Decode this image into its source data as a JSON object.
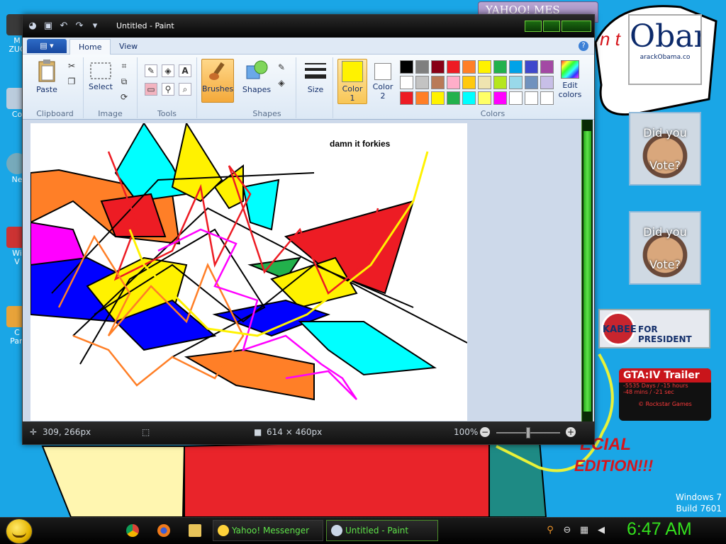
{
  "desktop": {
    "icons": [
      {
        "label": "M\nZUC"
      },
      {
        "label": "Co"
      },
      {
        "label": "Ne"
      },
      {
        "label": "Wi\nV"
      },
      {
        "label": "C\nPan"
      }
    ],
    "wallpaper_text": {
      "top": "n t",
      "bottom": "MID\nSOR\nSPECIAL\nEDITION!!!"
    },
    "watermark": {
      "os": "Windows 7",
      "build": "Build 7601"
    }
  },
  "gadgets": {
    "obama": {
      "big": "Obar",
      "small": "arackObama.co"
    },
    "vote1": {
      "line1": "Did you",
      "line2": "Vote?"
    },
    "vote2": {
      "line1": "Did you",
      "line2": "Vote?"
    },
    "huckabee": {
      "name": "KABEE",
      "suffix": "FOR PRESIDENT"
    },
    "gta": {
      "title": "GTA:IV Trailer",
      "line1": "-5535 Days / -15 hours",
      "line2": "-48 mins / -21 sec",
      "credit": "© Rockstar Games"
    }
  },
  "yahoo_bg": {
    "title": "YAHOO! MES"
  },
  "paint": {
    "title": "Untitled - Paint",
    "tabs": {
      "app_menu": "▤ ▾",
      "home": "Home",
      "view": "View"
    },
    "groups": {
      "clipboard": "Clipboard",
      "image": "Image",
      "tools": "Tools",
      "shapes": "Shapes",
      "colors": "Colors"
    },
    "buttons": {
      "paste": "Paste",
      "select": "Select",
      "brushes": "Brushes",
      "shapes": "Shapes",
      "size": "Size",
      "color1": "Color\n1",
      "color2": "Color\n2",
      "edit_colors": "Edit\ncolors"
    },
    "palette": [
      "#000000",
      "#7f7f7f",
      "#880015",
      "#ed1c24",
      "#ff7f27",
      "#fff200",
      "#22b14c",
      "#00a2e8",
      "#3f48cc",
      "#a349a4",
      "#ffffff",
      "#c3c3c3",
      "#b97a57",
      "#ffaec9",
      "#ffc90e",
      "#efe4b0",
      "#b5e61d",
      "#99d9ea",
      "#7092be",
      "#c8bfe7",
      "#ed1c24",
      "#ff7f27",
      "#fff200",
      "#22b14c",
      "#00ffff",
      "#ffff66",
      "#ff00ff",
      "#ffffff",
      "#ffffff",
      "#ffffff"
    ],
    "color1": "#fff200",
    "color2": "#ffffff",
    "canvas_caption": "damn it forkies",
    "status": {
      "cursor": "309, 266px",
      "size": "614 × 460px",
      "zoom": "100%"
    }
  },
  "taskbar": {
    "tasks": [
      {
        "label": "Yahoo! Messenger"
      },
      {
        "label": "Untitled - Paint"
      }
    ],
    "clock": "6:47 AM"
  }
}
